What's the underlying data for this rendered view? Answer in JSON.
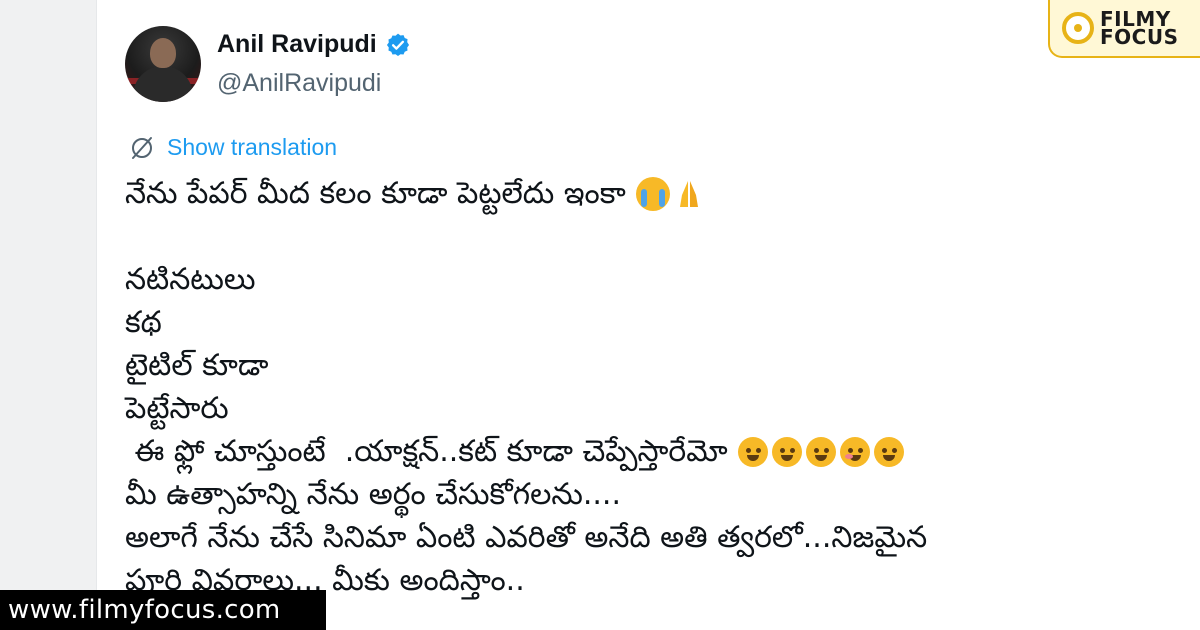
{
  "author": {
    "display_name": "Anil Ravipudi",
    "handle": "@AnilRavipudi",
    "avatar_icon": "profile-photo",
    "verified_icon": "verified-badge-icon",
    "verified_color": "#1d9bf0"
  },
  "translation": {
    "icon": "globe-slash-icon",
    "label": "Show translation",
    "color": "#1d9bf0"
  },
  "tweet": {
    "lines": [
      "నేను పేపర్ మీద కలం కూడా పెట్టలేదు ఇంకా",
      "",
      "నటినటులు",
      "కథ",
      "టైటిల్ కూడా",
      "పెట్టేసారు",
      " ఈ ఫ్లో చూస్తుంటే  .యాక్షన్..కట్ కూడా చెప్పేస్తారేమో",
      "మీ ఉత్సాహన్ని నేను అర్థం చేసుకోగలను....",
      "అలాగే నేను చేసే సినిమా ఏంటి ఎవరితో అనేది అతి త్వరలో...నిజమైన",
      "పూర్తి వివరాలు... మీకు అందిస్తాం.."
    ],
    "line1_emojis": [
      "crying-face-emoji",
      "folded-hands-emoji"
    ],
    "line7_emojis": [
      "winking-tongue-emoji",
      "winking-tongue-emoji",
      "winking-tongue-emoji",
      "smiling-blush-emoji",
      "grinning-squint-emoji"
    ]
  },
  "brand": {
    "line1": "FILMY",
    "line2": "FOCUS",
    "icon": "film-reel-icon",
    "accent": "#e7b317"
  },
  "watermark": {
    "text": "www.filmyfocus.com"
  }
}
